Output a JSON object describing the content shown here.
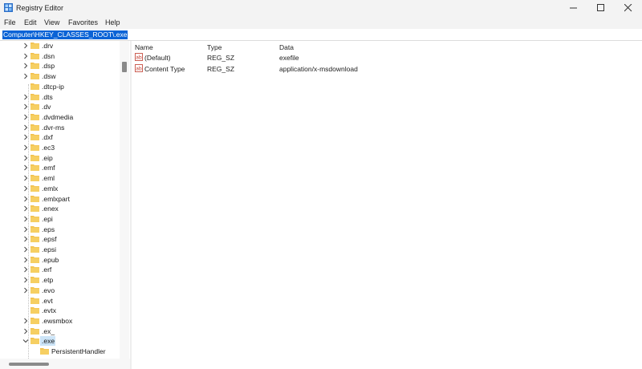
{
  "window": {
    "title": "Registry Editor"
  },
  "menu": [
    "File",
    "Edit",
    "View",
    "Favorites",
    "Help"
  ],
  "address": "Computer\\HKEY_CLASSES_ROOT\\.exe",
  "tree": {
    "items": [
      ".drv",
      ".dsn",
      ".dsp",
      ".dsw",
      ".dtcp-ip",
      ".dts",
      ".dv",
      ".dvdmedia",
      ".dvr-ms",
      ".dxf",
      ".ec3",
      ".eip",
      ".emf",
      ".eml",
      ".emlx",
      ".emlxpart",
      ".enex",
      ".epi",
      ".eps",
      ".epsf",
      ".epsi",
      ".epub",
      ".erf",
      ".etp",
      ".evo",
      ".evt",
      ".evtx",
      ".ewsmbox",
      ".ex_",
      ".exe"
    ],
    "no_chevron": [
      ".dtcp-ip",
      ".evt",
      ".evtx"
    ],
    "expanded": ".exe",
    "selected": ".exe",
    "child": "PersistentHandler"
  },
  "list": {
    "columns": [
      "Name",
      "Type",
      "Data"
    ],
    "rows": [
      {
        "name": "(Default)",
        "type": "REG_SZ",
        "data": "exefile"
      },
      {
        "name": "Content Type",
        "type": "REG_SZ",
        "data": "application/x-msdownload"
      }
    ]
  },
  "icons": {
    "app": "registry-editor-icon",
    "folder": "folder-icon",
    "value": "string-value-icon"
  },
  "colors": {
    "selection": "#0a63d6",
    "folder": "#f2c14e",
    "tree_selected": "#cce4f7"
  }
}
